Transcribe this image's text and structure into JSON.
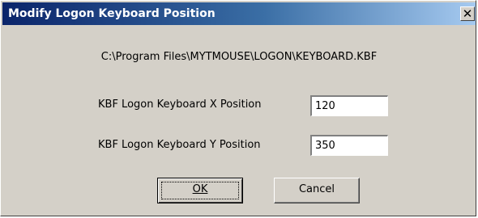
{
  "window": {
    "title": "Modify Logon Keyboard Position",
    "close_glyph": "✕",
    "close_icon": "close-icon"
  },
  "content": {
    "file_path": "C:\\Program Files\\MYTMOUSE\\LOGON\\KEYBOARD.KBF",
    "x_label": "KBF Logon Keyboard X Position",
    "x_value": "120",
    "y_label": "KBF Logon Keyboard Y Position",
    "y_value": "350"
  },
  "buttons": {
    "ok_label": "OK",
    "cancel_label": "Cancel"
  },
  "colors": {
    "titlebar_start": "#0a246a",
    "titlebar_end": "#a6caf0",
    "face": "#d4d0c8"
  }
}
